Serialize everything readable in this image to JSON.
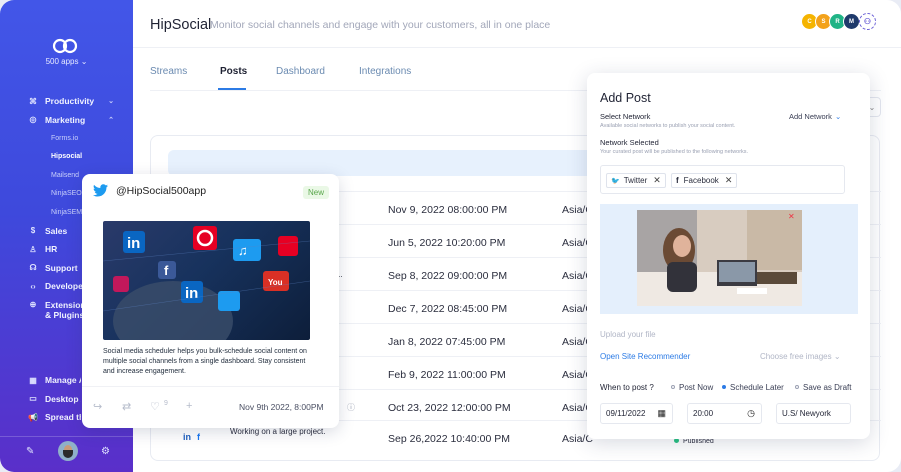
{
  "app": {
    "title": "HipSocial",
    "subtitle": "Monitor social channels and engage with your customers, all in one place"
  },
  "sidebar": {
    "apps_label": "500 apps",
    "items": [
      {
        "label": "Productivity",
        "icon": "command-icon",
        "chevron": "⌄"
      },
      {
        "label": "Marketing",
        "icon": "target-icon",
        "chevron": "⌃"
      }
    ],
    "sub_items": [
      {
        "label": "Forms.io",
        "active": false
      },
      {
        "label": "Hipsocial",
        "active": true
      },
      {
        "label": "Mailsend",
        "active": false
      },
      {
        "label": "NinjaSEO",
        "active": false
      },
      {
        "label": "NinjaSEM",
        "active": false
      }
    ],
    "items2": [
      {
        "label": "Sales",
        "icon": "dollar-icon"
      },
      {
        "label": "HR",
        "icon": "user-icon"
      },
      {
        "label": "Support",
        "icon": "headset-icon"
      },
      {
        "label": "Developer",
        "icon": "code-icon"
      },
      {
        "label": "Extensions & Plugins",
        "icon": "globe-icon"
      }
    ],
    "bottom_items": [
      {
        "label": "Manage Apps",
        "icon": "grid-icon"
      },
      {
        "label": "Desktop Apps",
        "icon": "desktop-icon"
      },
      {
        "label": "Spread the love",
        "icon": "megaphone-icon"
      }
    ]
  },
  "header": {
    "avatars": [
      {
        "initial": "C",
        "color": "#f5b400"
      },
      {
        "initial": "S",
        "color": "#f3a21b"
      },
      {
        "initial": "R",
        "color": "#20b486"
      },
      {
        "initial": "M",
        "color": "#1f3a6b"
      }
    ]
  },
  "tabs": [
    {
      "label": "Streams",
      "active": false
    },
    {
      "label": "Posts",
      "active": true
    },
    {
      "label": "Dashboard",
      "active": false
    },
    {
      "label": "Integrations",
      "active": false
    }
  ],
  "table": {
    "rows": [
      {
        "date": "Nov 9, 2022 08:00:00 PM",
        "tz": "Asia/C",
        "content": "",
        "social": "",
        "status": ""
      },
      {
        "date": "Jun 5, 2022 10:20:00 PM",
        "tz": "Asia/C",
        "content": "",
        "social": "",
        "status": ""
      },
      {
        "date": "Sep 8, 2022 09:00:00 PM",
        "tz": "Asia/C",
        "content": "de...",
        "social": "",
        "status": ""
      },
      {
        "date": "Dec 7, 2022 08:45:00 PM",
        "tz": "Asia/C",
        "content": "",
        "social": "",
        "status": ""
      },
      {
        "date": "Jan 8, 2022 07:45:00 PM",
        "tz": "Asia/C",
        "content": "",
        "social": "",
        "status": ""
      },
      {
        "date": "Feb 9, 2022 11:00:00 PM",
        "tz": "Asia/C",
        "content": "",
        "social": "",
        "status": ""
      },
      {
        "date": "Oct 23, 2022 12:00:00 PM",
        "tz": "Asia/C",
        "content": "",
        "social": "",
        "status": ""
      },
      {
        "date": "Sep 26,2022 10:40:00 PM",
        "tz": "Asia/C",
        "content": "Working on a large project.",
        "social": "in",
        "status": "Published"
      }
    ]
  },
  "tweet": {
    "handle": "@HipSocial500app",
    "badge": "New",
    "text": "Social media scheduler helps you bulk-schedule social content on multiple social channels from a single dashboard. Stay consistent and increase engagement.",
    "likes": "9",
    "date": "Nov 9th 2022, 8:00PM"
  },
  "add_post": {
    "title": "Add Post",
    "select_network": "Select Network",
    "select_hint": "Available social networks to publish your social content.",
    "add_network": "Add Network",
    "network_selected": "Network Selected",
    "selected_hint": "Your curated post will be published to the following networks.",
    "chips": [
      "Twitter",
      "Facebook"
    ],
    "upload_text": "Upload your file",
    "site_recommender": "Open Site Recommender",
    "free_images": "Choose free images",
    "when_label": "When to post ?",
    "options": [
      {
        "label": "Post Now",
        "selected": false
      },
      {
        "label": "Schedule Later",
        "selected": true
      },
      {
        "label": "Save as Draft",
        "selected": false
      }
    ],
    "date_value": "09/11/2022",
    "time_value": "20:00",
    "timezone_value": "U.S/ Newyork"
  }
}
